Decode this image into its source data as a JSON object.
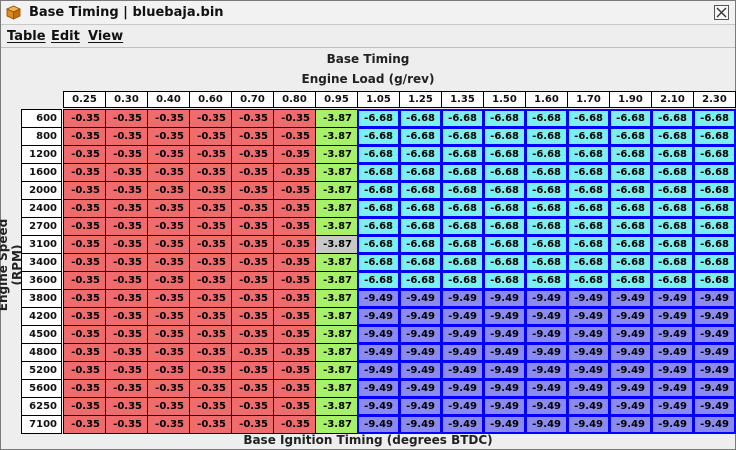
{
  "window": {
    "title": "Base Timing | bluebaja.bin",
    "close_icon": "close-icon",
    "app_icon": "cube-icon"
  },
  "menu": {
    "table_label": "Table",
    "edit_label": "Edit",
    "view_label": "View"
  },
  "table": {
    "title": "Base Timing",
    "x_axis_title": "Engine Load (g/rev)",
    "y_axis_title": "Engine Speed (RPM)",
    "footer_title": "Base Ignition Timing (degrees BTDC)",
    "columns": [
      "0.25",
      "0.30",
      "0.40",
      "0.60",
      "0.70",
      "0.80",
      "0.95",
      "1.05",
      "1.25",
      "1.35",
      "1.50",
      "1.60",
      "1.70",
      "1.90",
      "2.10",
      "2.30"
    ],
    "rows": [
      "600",
      "800",
      "1200",
      "1600",
      "2000",
      "2400",
      "2700",
      "3100",
      "3400",
      "3600",
      "3800",
      "4200",
      "4500",
      "4800",
      "5200",
      "5600",
      "6250",
      "7100"
    ],
    "values": [
      [
        "-0.35",
        "-0.35",
        "-0.35",
        "-0.35",
        "-0.35",
        "-0.35",
        "-3.87",
        "-6.68",
        "-6.68",
        "-6.68",
        "-6.68",
        "-6.68",
        "-6.68",
        "-6.68",
        "-6.68",
        "-6.68"
      ],
      [
        "-0.35",
        "-0.35",
        "-0.35",
        "-0.35",
        "-0.35",
        "-0.35",
        "-3.87",
        "-6.68",
        "-6.68",
        "-6.68",
        "-6.68",
        "-6.68",
        "-6.68",
        "-6.68",
        "-6.68",
        "-6.68"
      ],
      [
        "-0.35",
        "-0.35",
        "-0.35",
        "-0.35",
        "-0.35",
        "-0.35",
        "-3.87",
        "-6.68",
        "-6.68",
        "-6.68",
        "-6.68",
        "-6.68",
        "-6.68",
        "-6.68",
        "-6.68",
        "-6.68"
      ],
      [
        "-0.35",
        "-0.35",
        "-0.35",
        "-0.35",
        "-0.35",
        "-0.35",
        "-3.87",
        "-6.68",
        "-6.68",
        "-6.68",
        "-6.68",
        "-6.68",
        "-6.68",
        "-6.68",
        "-6.68",
        "-6.68"
      ],
      [
        "-0.35",
        "-0.35",
        "-0.35",
        "-0.35",
        "-0.35",
        "-0.35",
        "-3.87",
        "-6.68",
        "-6.68",
        "-6.68",
        "-6.68",
        "-6.68",
        "-6.68",
        "-6.68",
        "-6.68",
        "-6.68"
      ],
      [
        "-0.35",
        "-0.35",
        "-0.35",
        "-0.35",
        "-0.35",
        "-0.35",
        "-3.87",
        "-6.68",
        "-6.68",
        "-6.68",
        "-6.68",
        "-6.68",
        "-6.68",
        "-6.68",
        "-6.68",
        "-6.68"
      ],
      [
        "-0.35",
        "-0.35",
        "-0.35",
        "-0.35",
        "-0.35",
        "-0.35",
        "-3.87",
        "-6.68",
        "-6.68",
        "-6.68",
        "-6.68",
        "-6.68",
        "-6.68",
        "-6.68",
        "-6.68",
        "-6.68"
      ],
      [
        "-0.35",
        "-0.35",
        "-0.35",
        "-0.35",
        "-0.35",
        "-0.35",
        "-3.87",
        "-6.68",
        "-6.68",
        "-6.68",
        "-6.68",
        "-6.68",
        "-6.68",
        "-6.68",
        "-6.68",
        "-6.68"
      ],
      [
        "-0.35",
        "-0.35",
        "-0.35",
        "-0.35",
        "-0.35",
        "-0.35",
        "-3.87",
        "-6.68",
        "-6.68",
        "-6.68",
        "-6.68",
        "-6.68",
        "-6.68",
        "-6.68",
        "-6.68",
        "-6.68"
      ],
      [
        "-0.35",
        "-0.35",
        "-0.35",
        "-0.35",
        "-0.35",
        "-0.35",
        "-3.87",
        "-6.68",
        "-6.68",
        "-6.68",
        "-6.68",
        "-6.68",
        "-6.68",
        "-6.68",
        "-6.68",
        "-6.68"
      ],
      [
        "-0.35",
        "-0.35",
        "-0.35",
        "-0.35",
        "-0.35",
        "-0.35",
        "-3.87",
        "-9.49",
        "-9.49",
        "-9.49",
        "-9.49",
        "-9.49",
        "-9.49",
        "-9.49",
        "-9.49",
        "-9.49"
      ],
      [
        "-0.35",
        "-0.35",
        "-0.35",
        "-0.35",
        "-0.35",
        "-0.35",
        "-3.87",
        "-9.49",
        "-9.49",
        "-9.49",
        "-9.49",
        "-9.49",
        "-9.49",
        "-9.49",
        "-9.49",
        "-9.49"
      ],
      [
        "-0.35",
        "-0.35",
        "-0.35",
        "-0.35",
        "-0.35",
        "-0.35",
        "-3.87",
        "-9.49",
        "-9.49",
        "-9.49",
        "-9.49",
        "-9.49",
        "-9.49",
        "-9.49",
        "-9.49",
        "-9.49"
      ],
      [
        "-0.35",
        "-0.35",
        "-0.35",
        "-0.35",
        "-0.35",
        "-0.35",
        "-3.87",
        "-9.49",
        "-9.49",
        "-9.49",
        "-9.49",
        "-9.49",
        "-9.49",
        "-9.49",
        "-9.49",
        "-9.49"
      ],
      [
        "-0.35",
        "-0.35",
        "-0.35",
        "-0.35",
        "-0.35",
        "-0.35",
        "-3.87",
        "-9.49",
        "-9.49",
        "-9.49",
        "-9.49",
        "-9.49",
        "-9.49",
        "-9.49",
        "-9.49",
        "-9.49"
      ],
      [
        "-0.35",
        "-0.35",
        "-0.35",
        "-0.35",
        "-0.35",
        "-0.35",
        "-3.87",
        "-9.49",
        "-9.49",
        "-9.49",
        "-9.49",
        "-9.49",
        "-9.49",
        "-9.49",
        "-9.49",
        "-9.49"
      ],
      [
        "-0.35",
        "-0.35",
        "-0.35",
        "-0.35",
        "-0.35",
        "-0.35",
        "-3.87",
        "-9.49",
        "-9.49",
        "-9.49",
        "-9.49",
        "-9.49",
        "-9.49",
        "-9.49",
        "-9.49",
        "-9.49"
      ],
      [
        "-0.35",
        "-0.35",
        "-0.35",
        "-0.35",
        "-0.35",
        "-0.35",
        "-3.87",
        "-9.49",
        "-9.49",
        "-9.49",
        "-9.49",
        "-9.49",
        "-9.49",
        "-9.49",
        "-9.49",
        "-9.49"
      ]
    ],
    "highlighted_cell": {
      "row": 7,
      "col": 6
    },
    "colors": {
      "value_-0.35": "#f06b6b",
      "value_-3.87": "#a6f06a",
      "value_-6.68": "#7cf0f0",
      "value_-9.49": "#8a8af0",
      "highlight": "#c8c8c8",
      "cell_border": "#000000",
      "selection_border": "#0000ff"
    }
  }
}
